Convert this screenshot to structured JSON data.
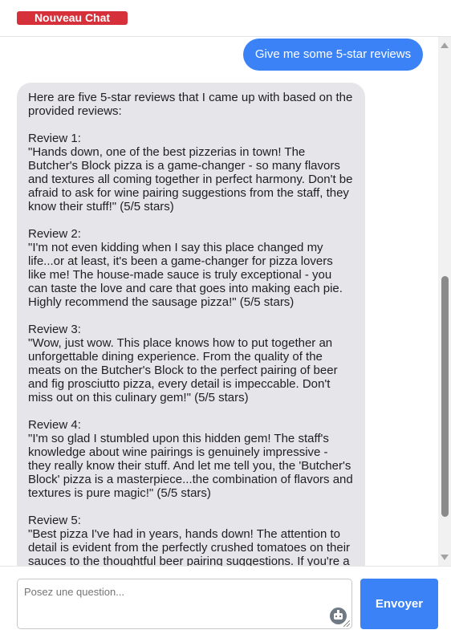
{
  "header": {
    "new_chat_label": "Nouveau Chat"
  },
  "conversation": {
    "user_message": "Give me some 5-star reviews",
    "assistant_message": {
      "intro": "Here are five 5-star reviews that I came up with based on the provided reviews:",
      "reviews": [
        {
          "heading": "Review 1:",
          "body": "\"Hands down, one of the best pizzerias in town! The Butcher's Block pizza is a game-changer - so many flavors and textures all coming together in perfect harmony. Don't be afraid to ask for wine pairing suggestions from the staff, they know their stuff!\" (5/5 stars)"
        },
        {
          "heading": "Review 2:",
          "body": "\"I'm not even kidding when I say this place changed my life...or at least, it's been a game-changer for pizza lovers like me! The house-made sauce is truly exceptional - you can taste the love and care that goes into making each pie. Highly recommend the sausage pizza!\" (5/5 stars)"
        },
        {
          "heading": "Review 3:",
          "body": "\"Wow, just wow. This place knows how to put together an unforgettable dining experience. From the quality of the meats on the Butcher's Block to the perfect pairing of beer and fig prosciutto pizza, every detail is impeccable. Don't miss out on this culinary gem!\" (5/5 stars)"
        },
        {
          "heading": "Review 4:",
          "body": "\"I'm so glad I stumbled upon this hidden gem! The staff's knowledge about wine pairings is genuinely impressive - they really know their stuff. And let me tell you, the 'Butcher's Block' pizza is a masterpiece...the combination of flavors and textures is pure magic!\" (5/5 stars)"
        },
        {
          "heading": "Review 5:",
          "body": "\"Best pizza I've had in years, hands down! The attention to detail is evident from the perfectly crushed tomatoes on their sauces to the thoughtful beer pairing suggestions. If you're a"
        }
      ]
    }
  },
  "composer": {
    "placeholder": "Posez une question...",
    "send_label": "Envoyer",
    "assistant_icon": "robot-icon"
  },
  "colors": {
    "accent": "#3b82f6",
    "new_chat": "#d6303b",
    "bot_bubble": "#e5e5ea"
  }
}
